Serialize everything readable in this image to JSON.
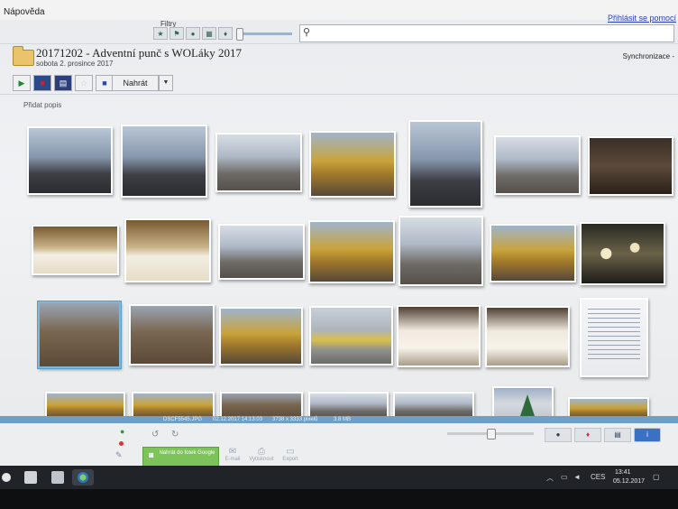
{
  "menubar": {
    "help": "Nápověda",
    "signin": "Přihlásit se pomocí"
  },
  "filters": {
    "label": "Filtry",
    "icons": [
      "star-icon",
      "flag-icon",
      "person-icon",
      "film-icon",
      "pin-icon"
    ]
  },
  "search": {
    "placeholder": ""
  },
  "folder": {
    "title": "20171202 - Adventní punč s WOLáky 2017",
    "date": "sobota 2. prosince 2017",
    "sync": "Synchronizace -"
  },
  "toolbar": {
    "upload_label": "Nahrát"
  },
  "description": {
    "add_label": "Přidat popis"
  },
  "selected_photo": {
    "filename": "DSCF5545.JPG",
    "datetime": "02.12.2017 14:13:03",
    "dimensions": "3738 x 3333 pixelů",
    "size": "3.8 MB"
  },
  "bottom": {
    "google_button": "Nahrát do fotek Google",
    "actions": [
      "E-mail",
      "Vytisknout",
      "Export"
    ]
  },
  "taskbar": {
    "lang": "CES",
    "time": "13:41",
    "date": "05.12.2017"
  }
}
